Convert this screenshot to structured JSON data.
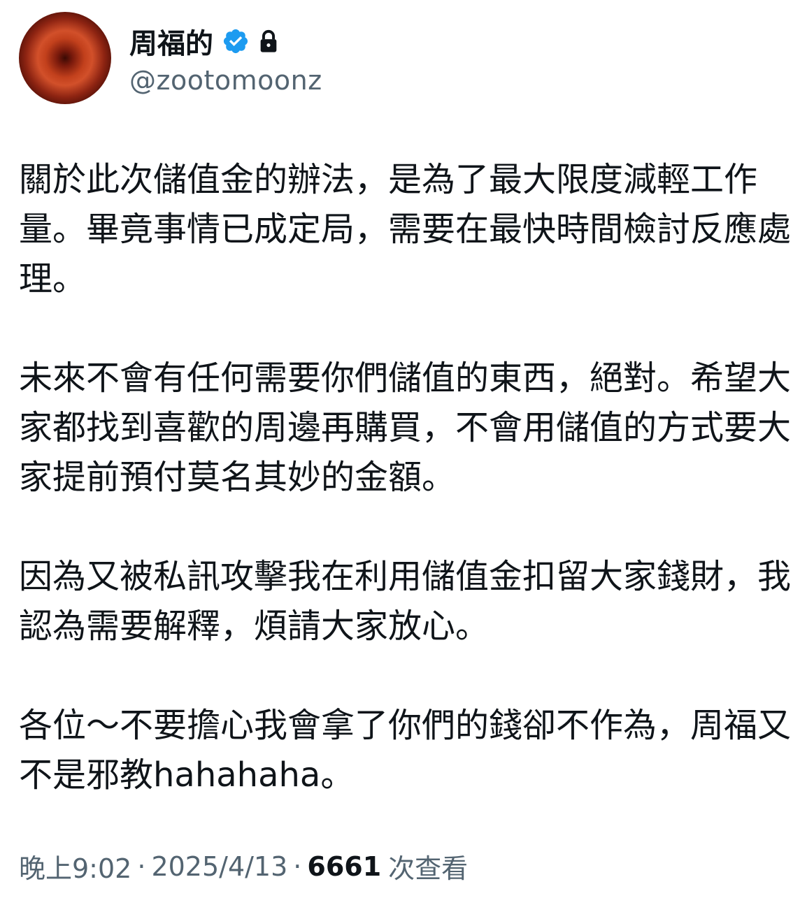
{
  "author": {
    "display_name": "周福的",
    "handle": "@zootomoonz",
    "verified_color": "#1d9bf0",
    "icons": [
      "avatar",
      "verified-badge-icon",
      "lock-icon"
    ]
  },
  "tweet": {
    "paragraphs": [
      "關於此次儲值金的辦法，是為了最大限度減輕工作量。畢竟事情已成定局，需要在最快時間檢討反應處理。",
      "未來不會有任何需要你們儲值的東西，絕對。希望大家都找到喜歡的周邊再購買，不會用儲值的方式要大家提前預付莫名其妙的金額。",
      "因為又被私訊攻擊我在利用儲值金扣留大家錢財，我認為需要解釋，煩請大家放心。",
      "各位～不要擔心我會拿了你們的錢卻不作為，周福又不是邪教hahahaha。"
    ]
  },
  "meta": {
    "time": "晚上9:02",
    "separator": "·",
    "date": "2025/4/13",
    "views_count": "6661",
    "views_label": "次查看"
  }
}
